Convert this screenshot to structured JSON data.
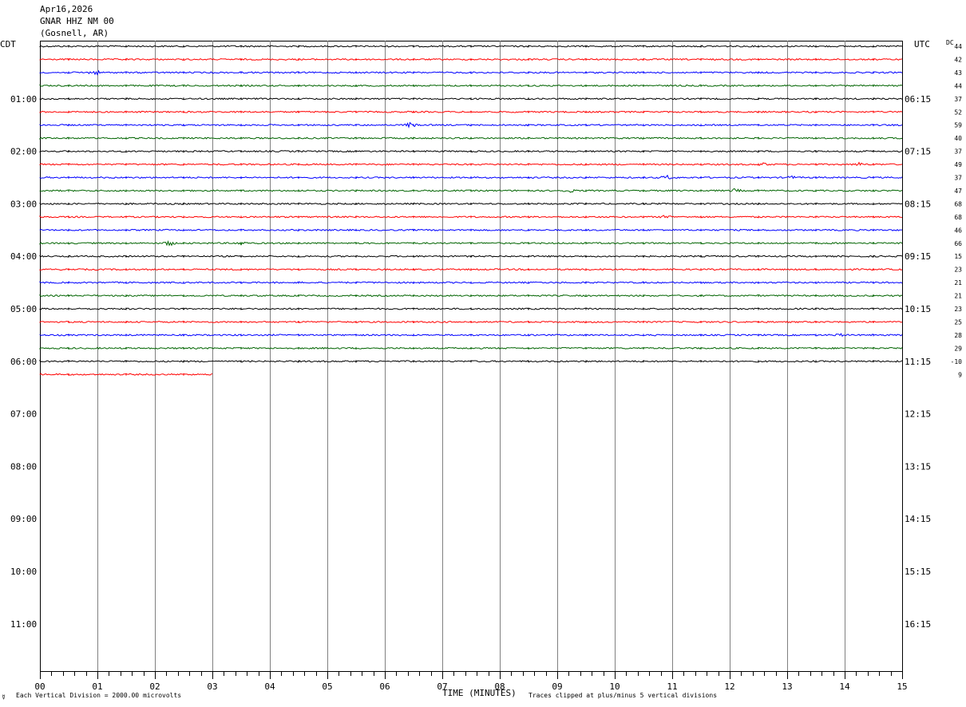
{
  "header": {
    "date": "Apr16,2026",
    "station": "GNAR HHZ NM 00",
    "location": "(Gosnell, AR)"
  },
  "left_tz": "CDT",
  "right_tz": "UTC",
  "dc_label": "DC",
  "footer": {
    "scale_note": "Each Vertical Division = 2000.00 microvolts",
    "clip_note": "Traces clipped at plus/minus 5 vertical divisions",
    "corner_mark": "☿"
  },
  "colors": {
    "black": "#000000",
    "red": "#ff0000",
    "blue": "#0000ff",
    "green": "#006400",
    "grid": "#808080"
  },
  "chart_data": {
    "type": "line",
    "xlabel": "TIME (MINUTES)",
    "ylabel": "",
    "x_ticks": [
      "00",
      "01",
      "02",
      "03",
      "04",
      "05",
      "06",
      "07",
      "08",
      "09",
      "10",
      "11",
      "12",
      "13",
      "14",
      "15"
    ],
    "xlim": [
      0,
      15
    ],
    "left_hour_labels": [
      "01:00",
      "02:00",
      "03:00",
      "04:00",
      "05:00",
      "06:00",
      "07:00",
      "08:00",
      "09:00",
      "10:00",
      "11:00"
    ],
    "right_hour_labels": [
      "06:15",
      "07:15",
      "08:15",
      "09:15",
      "10:15",
      "11:15",
      "12:15",
      "13:15",
      "14:15",
      "15:15",
      "16:15"
    ],
    "rows_per_hour": 4,
    "total_rows": 48,
    "trace_color_cycle": [
      "black",
      "red",
      "blue",
      "green"
    ],
    "traces": [
      {
        "row": 0,
        "color": "black",
        "end_minute": 15,
        "dc": "44"
      },
      {
        "row": 1,
        "color": "red",
        "end_minute": 15,
        "dc": "42"
      },
      {
        "row": 2,
        "color": "blue",
        "end_minute": 15,
        "dc": "43"
      },
      {
        "row": 3,
        "color": "green",
        "end_minute": 15,
        "dc": "44"
      },
      {
        "row": 4,
        "color": "black",
        "end_minute": 15,
        "dc": "37"
      },
      {
        "row": 5,
        "color": "red",
        "end_minute": 15,
        "dc": "52"
      },
      {
        "row": 6,
        "color": "blue",
        "end_minute": 15,
        "dc": "59"
      },
      {
        "row": 7,
        "color": "green",
        "end_minute": 15,
        "dc": "40"
      },
      {
        "row": 8,
        "color": "black",
        "end_minute": 15,
        "dc": "37"
      },
      {
        "row": 9,
        "color": "red",
        "end_minute": 15,
        "dc": "49"
      },
      {
        "row": 10,
        "color": "blue",
        "end_minute": 15,
        "dc": "37"
      },
      {
        "row": 11,
        "color": "green",
        "end_minute": 15,
        "dc": "47"
      },
      {
        "row": 12,
        "color": "black",
        "end_minute": 15,
        "dc": "68"
      },
      {
        "row": 13,
        "color": "red",
        "end_minute": 15,
        "dc": "68"
      },
      {
        "row": 14,
        "color": "blue",
        "end_minute": 15,
        "dc": "46"
      },
      {
        "row": 15,
        "color": "green",
        "end_minute": 15,
        "dc": "66"
      },
      {
        "row": 16,
        "color": "black",
        "end_minute": 15,
        "dc": "15"
      },
      {
        "row": 17,
        "color": "red",
        "end_minute": 15,
        "dc": "23"
      },
      {
        "row": 18,
        "color": "blue",
        "end_minute": 15,
        "dc": "21"
      },
      {
        "row": 19,
        "color": "green",
        "end_minute": 15,
        "dc": "21"
      },
      {
        "row": 20,
        "color": "black",
        "end_minute": 15,
        "dc": "23"
      },
      {
        "row": 21,
        "color": "red",
        "end_minute": 15,
        "dc": "25"
      },
      {
        "row": 22,
        "color": "blue",
        "end_minute": 15,
        "dc": "28"
      },
      {
        "row": 23,
        "color": "green",
        "end_minute": 15,
        "dc": "29"
      },
      {
        "row": 24,
        "color": "black",
        "end_minute": 15,
        "dc": "-10"
      },
      {
        "row": 25,
        "color": "red",
        "end_minute": 3,
        "dc": "9"
      }
    ],
    "events": [
      {
        "row": 2,
        "minute": 0.95,
        "amp": 3
      },
      {
        "row": 6,
        "minute": 6.45,
        "amp": 3
      },
      {
        "row": 9,
        "minute": 14.25,
        "amp": 2
      },
      {
        "row": 9,
        "minute": 12.6,
        "amp": 1.5
      },
      {
        "row": 10,
        "minute": 10.9,
        "amp": 2.5
      },
      {
        "row": 10,
        "minute": 13.05,
        "amp": 2
      },
      {
        "row": 11,
        "minute": 9.2,
        "amp": 2
      },
      {
        "row": 11,
        "minute": 12.1,
        "amp": 2
      },
      {
        "row": 13,
        "minute": 10.9,
        "amp": 2
      },
      {
        "row": 15,
        "minute": 2.25,
        "amp": 3
      },
      {
        "row": 15,
        "minute": 3.5,
        "amp": 2
      },
      {
        "row": 22,
        "minute": 13.9,
        "amp": 1.5
      }
    ]
  }
}
